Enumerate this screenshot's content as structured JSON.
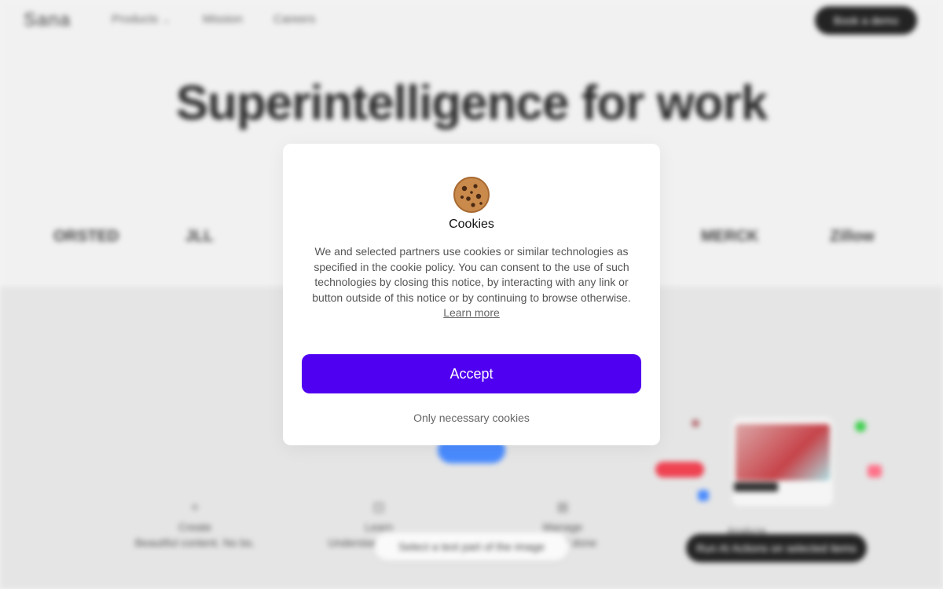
{
  "header": {
    "logo": "Sana",
    "nav": [
      "Products",
      "Mission",
      "Careers"
    ],
    "cta": "Book a demo"
  },
  "hero": {
    "title": "Superintelligence for work"
  },
  "brands": [
    "ORSTED",
    "JLL",
    "",
    "",
    "",
    "MERCK",
    "Zillow"
  ],
  "features": [
    {
      "icon": "+",
      "title": "Create",
      "desc": "Beautiful content. No bs."
    },
    {
      "icon": "⊡",
      "title": "Learn",
      "desc": "Understand anything"
    },
    {
      "icon": "⊞",
      "title": "Manage",
      "desc": "Get it all done"
    },
    {
      "icon": "",
      "title": "Analyze",
      "desc": ""
    }
  ],
  "overlays": {
    "select_pill": "Select a text part of the image",
    "dark_pill": "Run AI Actions on selected items"
  },
  "cookie": {
    "emoji": "🍪",
    "title": "Cookies",
    "body": "We and selected partners use cookies or similar technologies as specified in the cookie policy. You can consent to the use of such technologies by closing this notice, by interacting with any link or button outside of this notice or by continuing to browse otherwise.",
    "learn_more": "Learn more",
    "accept": "Accept",
    "necessary": "Only necessary cookies"
  },
  "colors": {
    "accept_bg": "#5000f0",
    "page_bg": "#f0f0f0"
  }
}
